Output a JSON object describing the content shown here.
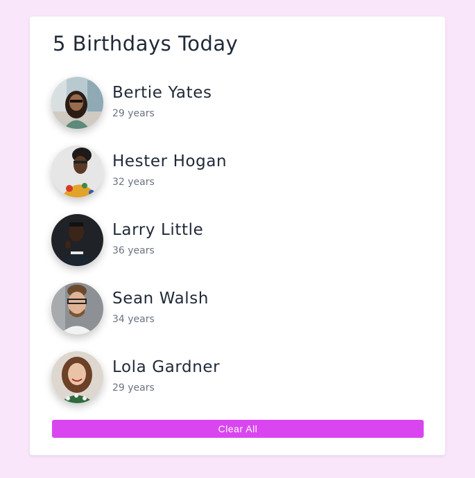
{
  "title": "5 Birthdays Today",
  "people": [
    {
      "name": "Bertie Yates",
      "age": "29 years"
    },
    {
      "name": "Hester Hogan",
      "age": "32 years"
    },
    {
      "name": "Larry Little",
      "age": "36 years"
    },
    {
      "name": "Sean Walsh",
      "age": "34 years"
    },
    {
      "name": "Lola Gardner",
      "age": "29 years"
    }
  ],
  "clear_button_label": "Clear All",
  "colors": {
    "page_background": "#f9e6fb",
    "card_background": "#ffffff",
    "button": "#d946ef",
    "name_text": "#1f2937",
    "age_text": "#6b7280"
  }
}
